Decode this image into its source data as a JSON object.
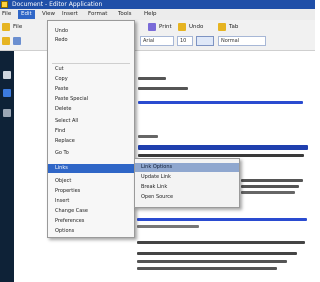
{
  "window": {
    "title": "Document - Editor Application"
  },
  "menubar": {
    "items": [
      "File",
      "Edit",
      "View",
      "Insert",
      "Format",
      "Tools",
      "Help"
    ],
    "active_index": 1
  },
  "toolbar": {
    "row1": [
      {
        "label": "File",
        "icon": "folder-icon",
        "color": "#e6b422"
      },
      {
        "label": "Print",
        "icon": "printer-icon",
        "color": "#7a6bd8"
      },
      {
        "label": "Undo",
        "icon": "undo-icon",
        "color": "#e6b422"
      },
      {
        "label": "Tab",
        "icon": "tab-icon",
        "color": "#e6b422"
      }
    ],
    "row2": {
      "left_icons": [
        "save-icon",
        "copy-icon"
      ],
      "font_field": "Arial",
      "size_field": "10",
      "right_field": "Normal"
    }
  },
  "edit_menu": {
    "items": [
      {
        "label": "Undo",
        "shortcut": ""
      },
      {
        "label": "Redo",
        "shortcut": ""
      },
      {
        "label": "Cut",
        "shortcut": ""
      },
      {
        "label": "Copy",
        "shortcut": ""
      },
      {
        "label": "Paste",
        "shortcut": ""
      },
      {
        "label": "Paste Special",
        "shortcut": ""
      },
      {
        "label": "Delete",
        "shortcut": ""
      },
      {
        "label": "Select All",
        "shortcut": ""
      },
      {
        "label": "Find",
        "shortcut": ""
      },
      {
        "label": "Replace",
        "shortcut": ""
      },
      {
        "label": "Go To",
        "shortcut": ""
      },
      {
        "label": "Links",
        "shortcut": ""
      },
      {
        "label": "Object",
        "shortcut": ""
      },
      {
        "label": "Properties",
        "shortcut": ""
      },
      {
        "label": "Insert",
        "shortcut": ""
      },
      {
        "label": "Change Case",
        "shortcut": ""
      },
      {
        "label": "Preferences",
        "shortcut": ""
      },
      {
        "label": "Options",
        "shortcut": ""
      }
    ],
    "highlight_index": 11
  },
  "submenu": {
    "items": [
      "Link Options",
      "Update Link",
      "Break Link",
      "Open Source"
    ],
    "highlight_index": 0
  },
  "colors": {
    "titlebar": "#1f4fa8",
    "highlight": "#2f66c7",
    "sidebar": "#0e2237",
    "text_blue": "#2a4bd0"
  }
}
